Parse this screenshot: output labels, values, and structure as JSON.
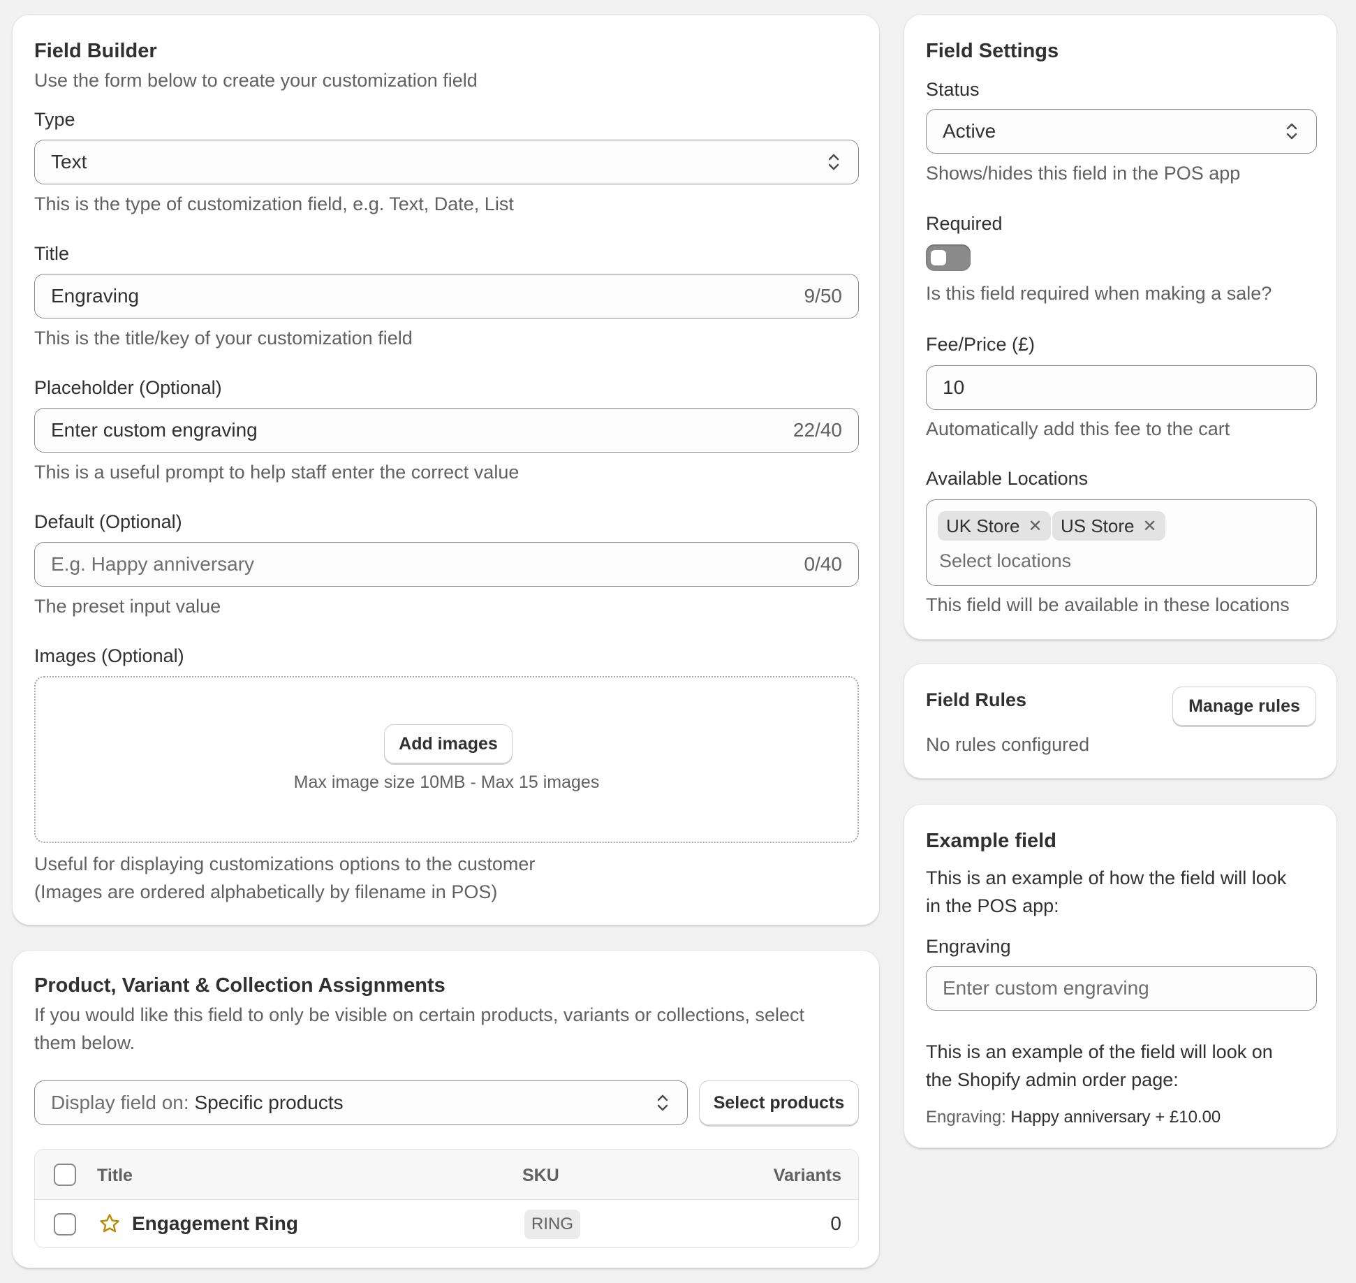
{
  "field_builder": {
    "title": "Field Builder",
    "subtitle": "Use the form below to create your customization field",
    "type": {
      "label": "Type",
      "value": "Text",
      "help": "This is the type of customization field, e.g. Text, Date, List"
    },
    "title_field": {
      "label": "Title",
      "value": "Engraving",
      "counter": "9/50",
      "help": "This is the title/key of your customization field"
    },
    "placeholder_field": {
      "label": "Placeholder (Optional)",
      "value": "Enter custom engraving",
      "counter": "22/40",
      "help": "This is a useful prompt to help staff enter the correct value"
    },
    "default_field": {
      "label": "Default (Optional)",
      "placeholder": "E.g. Happy anniversary",
      "counter": "0/40",
      "help": "The preset input value"
    },
    "images": {
      "label": "Images (Optional)",
      "button": "Add images",
      "limits": "Max image size 10MB - Max 15 images",
      "help_line1": "Useful for displaying customizations options to the customer",
      "help_line2": "(Images are ordered alphabetically by filename in POS)"
    }
  },
  "assignments": {
    "title": "Product, Variant & Collection Assignments",
    "subtitle_line1": "If you would like this field to only be visible on certain products, variants or collections, select",
    "subtitle_line2": "them below.",
    "display_prefix": "Display field on:",
    "display_value": "Specific products",
    "select_button": "Select products",
    "columns": [
      "Title",
      "SKU",
      "Variants"
    ],
    "rows": [
      {
        "title": "Engagement Ring",
        "sku": "RING",
        "variants": "0"
      }
    ]
  },
  "field_settings": {
    "title": "Field Settings",
    "status": {
      "label": "Status",
      "value": "Active",
      "help": "Shows/hides this field in the POS app"
    },
    "required": {
      "label": "Required",
      "enabled": false,
      "help": "Is this field required when making a sale?"
    },
    "fee": {
      "label": "Fee/Price (£)",
      "value": "10",
      "help": "Automatically add this fee to the cart"
    },
    "locations": {
      "label": "Available Locations",
      "chips": [
        "UK Store",
        "US Store"
      ],
      "placeholder": "Select locations",
      "help": "This field will be available in these locations"
    }
  },
  "field_rules": {
    "title": "Field Rules",
    "button": "Manage rules",
    "empty": "No rules configured"
  },
  "example": {
    "title": "Example field",
    "desc1_line1": "This is an example of how the field will look",
    "desc1_line2": "in the POS app:",
    "field_label": "Engraving",
    "field_placeholder": "Enter custom engraving",
    "desc2_line1": "This is an example of the field will look on",
    "desc2_line2": "the Shopify admin order page:",
    "order_key": "Engraving:",
    "order_value": "Happy anniversary + £10.00"
  },
  "colors": {
    "background": "#f1f1f1",
    "card": "#ffffff",
    "text": "#303030",
    "muted": "#616161",
    "border": "#8a8a8a",
    "star": "#b98900"
  },
  "icons": [
    "chevron-updown-icon",
    "close-icon",
    "star-icon"
  ]
}
